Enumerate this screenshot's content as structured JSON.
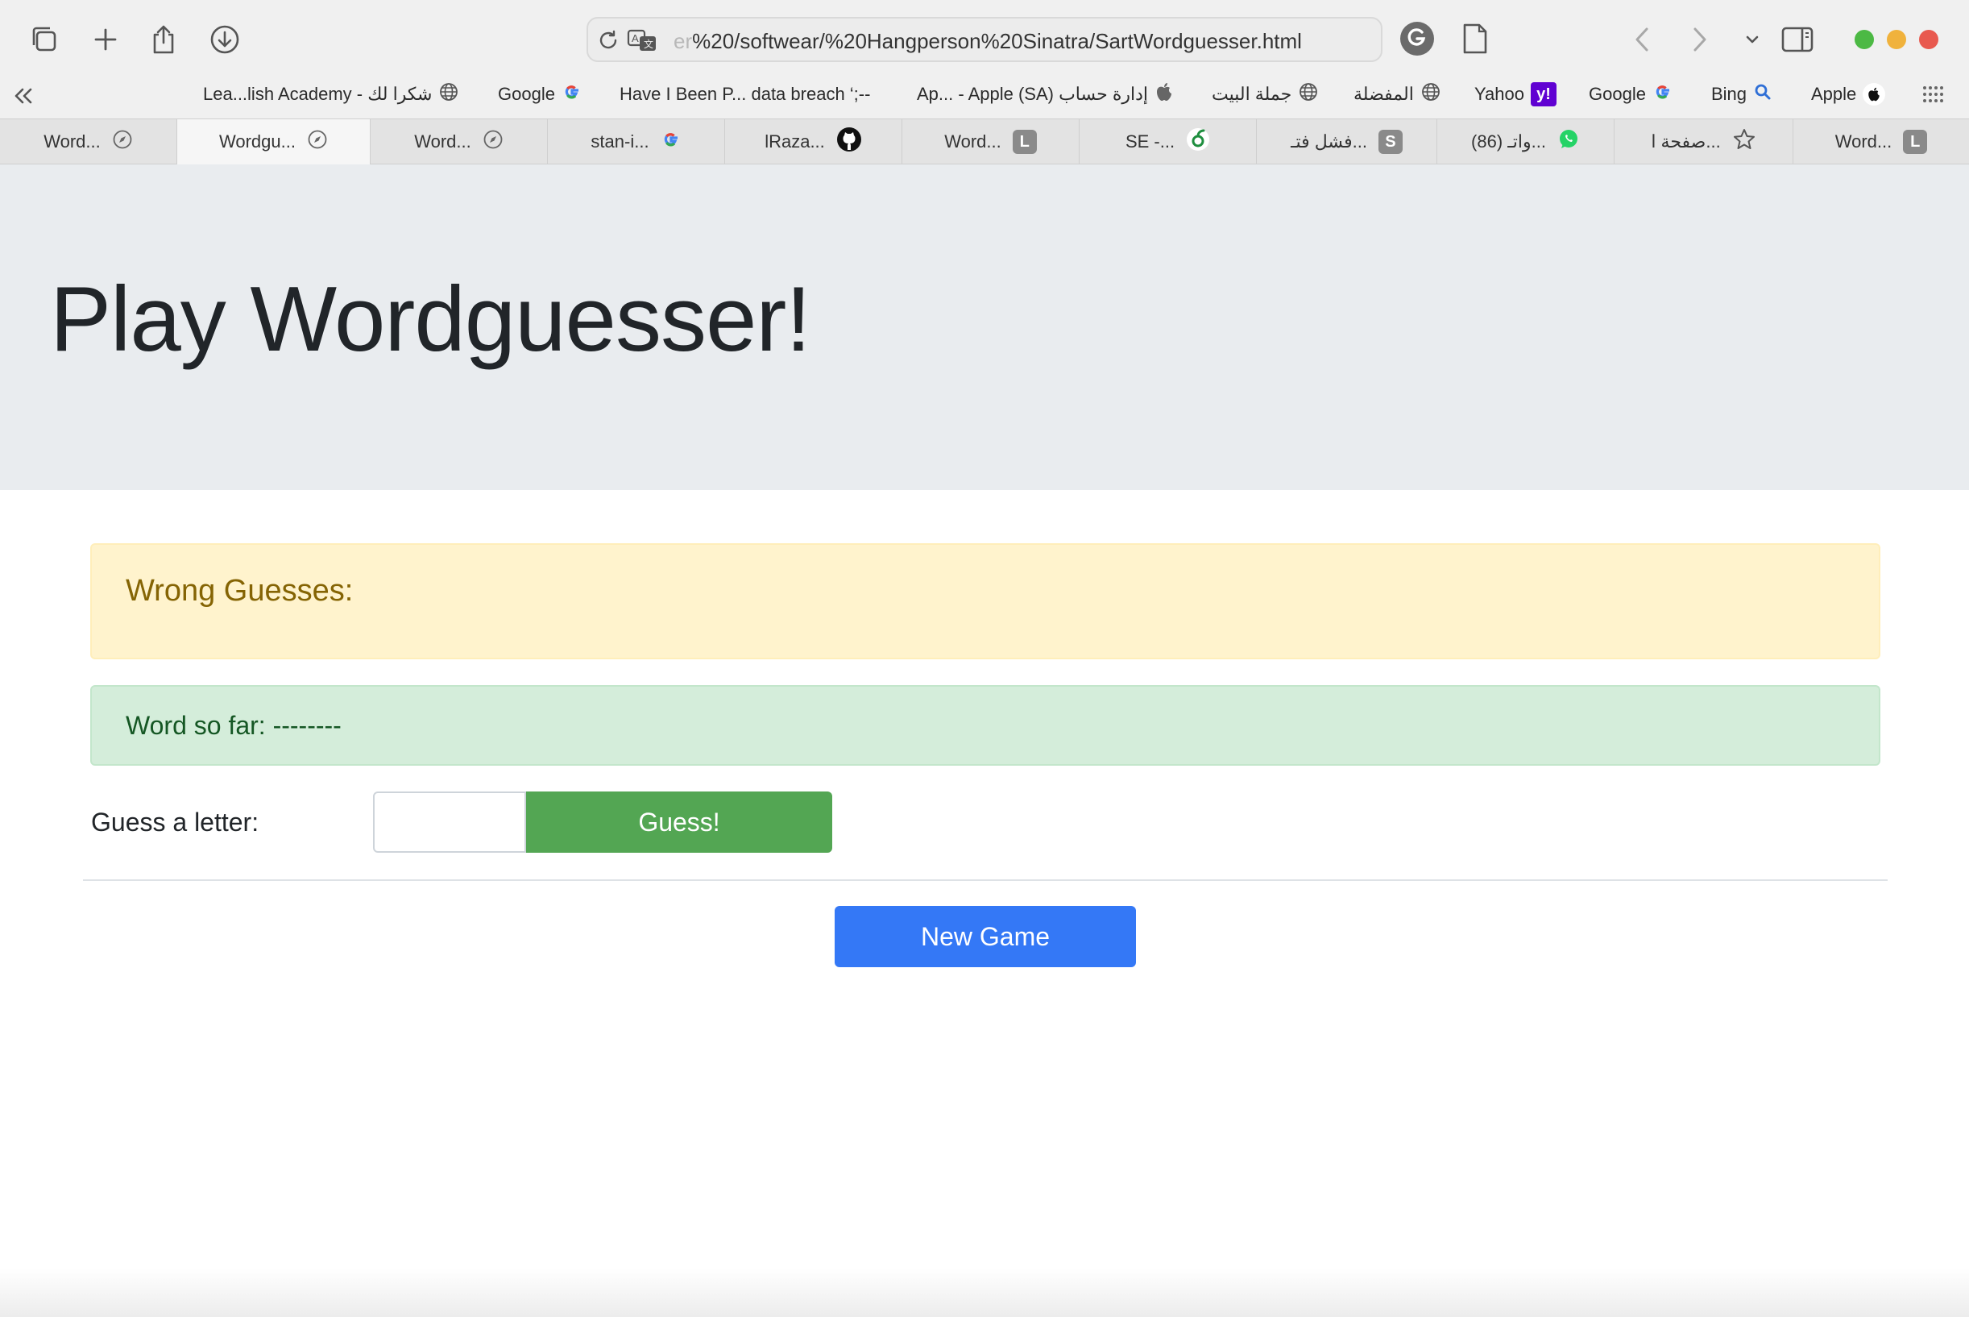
{
  "browser": {
    "url_faded": "er",
    "url": "%20/softwear/%20Hangperson%20Sinatra/SartWordguesser.html",
    "bookmarks": [
      {
        "label": "Lea...lish Academy - شكرا لك",
        "icon": "globe-icon"
      },
      {
        "label": "Google",
        "icon": "google-icon"
      },
      {
        "label": "Have I Been P... data breach ‘;--",
        "icon": ""
      },
      {
        "label": "Ap... - Apple (SA) إدارة حساب",
        "icon": "apple-icon"
      },
      {
        "label": "جملة البيت",
        "icon": "globe-icon"
      },
      {
        "label": "المفضلة",
        "icon": "globe-icon"
      },
      {
        "label": "Yahoo",
        "icon": "yahoo-icon"
      },
      {
        "label": "Google",
        "icon": "google-icon"
      },
      {
        "label": "Bing",
        "icon": "search-icon"
      },
      {
        "label": "Apple",
        "icon": "apple-icon"
      }
    ],
    "tabs": [
      {
        "label": "Word...",
        "icon": "compass-icon"
      },
      {
        "label": "Wordgu...",
        "icon": "compass-icon"
      },
      {
        "label": "Word...",
        "icon": "compass-icon"
      },
      {
        "label": "stan-i...",
        "icon": "google-icon"
      },
      {
        "label": "lRaza...",
        "icon": "github-icon"
      },
      {
        "label": "Word...",
        "icon": "l-icon",
        "icon_text": "L"
      },
      {
        "label": "SE -...",
        "icon": "leaf-icon"
      },
      {
        "label": "فشل فتـ...",
        "icon": "s-icon",
        "icon_text": "S"
      },
      {
        "label": "(86) واتـ...",
        "icon": "whatsapp-icon"
      },
      {
        "label": "صفحة ا...",
        "icon": "star-icon"
      },
      {
        "label": "Word...",
        "icon": "l-icon",
        "icon_text": "L"
      }
    ],
    "yahoo_icon_text": "y!"
  },
  "page": {
    "title": "Play Wordguesser!",
    "wrong_guesses_label": "Wrong Guesses:",
    "word_so_far_label": "Word so far: --------",
    "guess_label": "Guess a letter:",
    "guess_input_value": "",
    "guess_button": "Guess!",
    "new_game_button": "New Game"
  },
  "colors": {
    "jumbotron": "#e9ecef",
    "warning_bg": "#fff3cd",
    "success_bg": "#d4edda",
    "guess_button": "#53a653",
    "new_game_button": "#3478f6"
  }
}
